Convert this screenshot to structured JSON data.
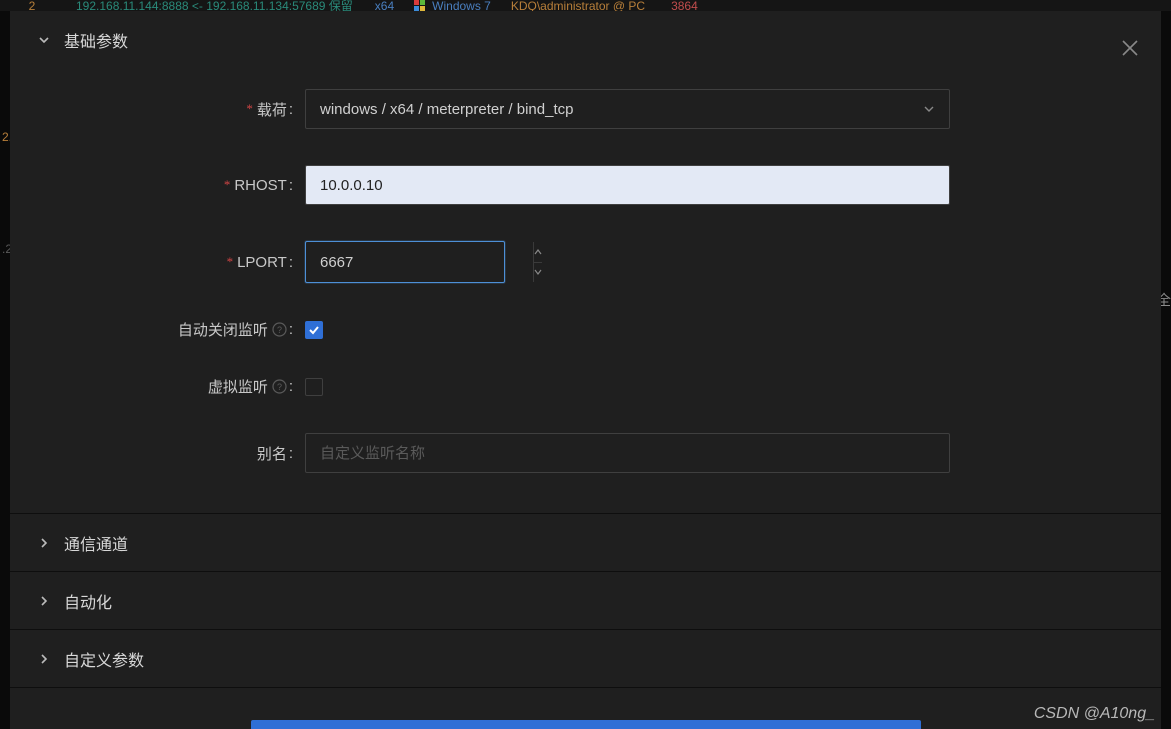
{
  "header_row": {
    "index": "2",
    "connection": "192.168.11.144:8888 <- 192.168.11.134:57689 保留",
    "arch": "x64",
    "os": "Windows 7",
    "user": "KDQ\\administrator @ PC",
    "pid": "3864"
  },
  "side": {
    "left1": "2.",
    "left2": ".2",
    "right": "全"
  },
  "panels": {
    "basic": {
      "title": "基础参数",
      "open": true
    },
    "channel": {
      "title": "通信通道",
      "open": false
    },
    "auto": {
      "title": "自动化",
      "open": false
    },
    "custom": {
      "title": "自定义参数",
      "open": false
    }
  },
  "form": {
    "payload": {
      "label": "载荷",
      "value": "windows / x64 / meterpreter / bind_tcp"
    },
    "rhost": {
      "label": "RHOST",
      "value": "10.0.0.10"
    },
    "lport": {
      "label": "LPORT",
      "value": "6667"
    },
    "autoclose": {
      "label": "自动关闭监听",
      "checked": true
    },
    "virtual": {
      "label": "虚拟监听",
      "checked": false
    },
    "alias": {
      "label": "别名",
      "placeholder": "自定义监听名称"
    }
  },
  "watermark": "CSDN @A10ng_"
}
